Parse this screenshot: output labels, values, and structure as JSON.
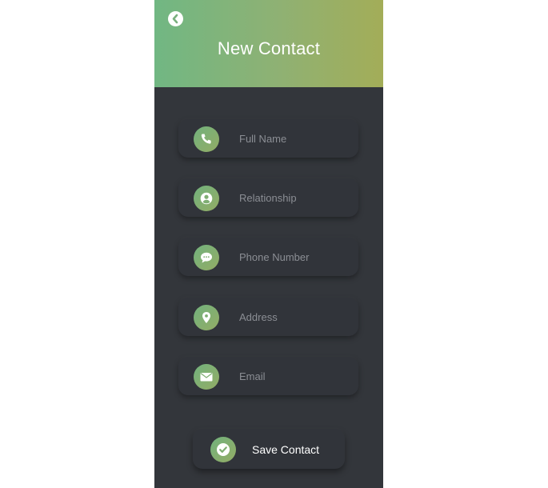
{
  "header": {
    "title": "New Contact",
    "back_icon": "back-arrow-circle-icon",
    "gradient": [
      "#71b783",
      "#a3ad58"
    ]
  },
  "form": {
    "fields": [
      {
        "name": "full-name",
        "placeholder": "Full Name",
        "value": "",
        "icon": "phone-icon"
      },
      {
        "name": "relationship",
        "placeholder": "Relationship",
        "value": "",
        "icon": "user-circle-icon"
      },
      {
        "name": "phone-number",
        "placeholder": "Phone Number",
        "value": "",
        "icon": "chat-bubble-icon"
      },
      {
        "name": "address",
        "placeholder": "Address",
        "value": "",
        "icon": "map-pin-icon"
      },
      {
        "name": "email",
        "placeholder": "Email",
        "value": "",
        "icon": "envelope-icon"
      }
    ]
  },
  "actions": {
    "save_label": "Save Contact",
    "save_icon": "check-circle-icon"
  },
  "colors": {
    "background": "#33363b",
    "accent": "#7fb177",
    "placeholder": "#8b8e94"
  }
}
